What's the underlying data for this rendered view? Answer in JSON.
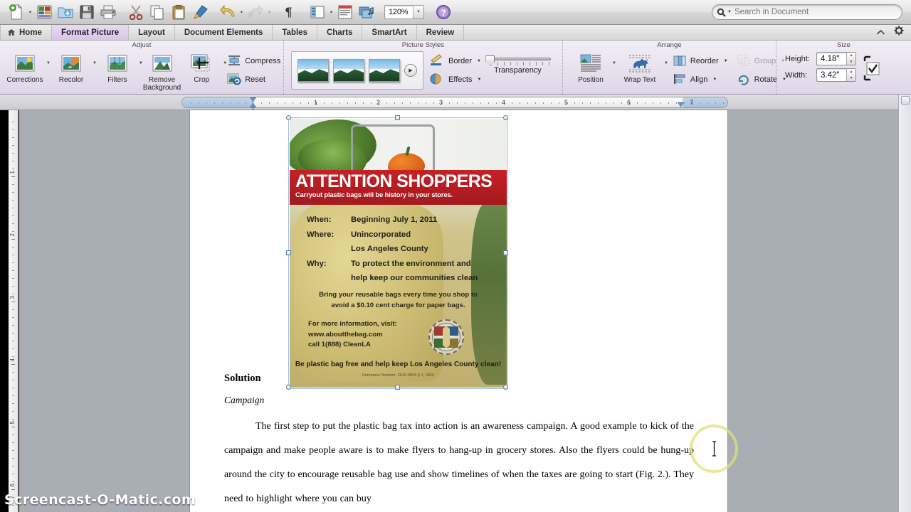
{
  "toolbar": {
    "buttons": [
      {
        "name": "new-document-button",
        "icon": "new-doc-icon",
        "has_arrow": true
      },
      {
        "name": "open-template-gallery-button",
        "icon": "template-gallery-icon",
        "has_arrow": false
      },
      {
        "name": "open-button",
        "icon": "open-folder-icon",
        "has_arrow": false
      },
      {
        "name": "save-button",
        "icon": "floppy-disk-icon",
        "has_arrow": false
      },
      {
        "name": "print-button",
        "icon": "printer-icon",
        "has_arrow": false
      },
      {
        "name": "cut-button",
        "icon": "scissors-icon",
        "has_arrow": false
      },
      {
        "name": "copy-button",
        "icon": "copy-pages-icon",
        "has_arrow": false
      },
      {
        "name": "paste-button",
        "icon": "clipboard-icon",
        "has_arrow": false
      },
      {
        "name": "format-painter-button",
        "icon": "paintbrush-icon",
        "has_arrow": false
      },
      {
        "name": "undo-button",
        "icon": "undo-arrow-icon",
        "has_arrow": true
      },
      {
        "name": "redo-button",
        "icon": "redo-arrow-icon",
        "has_arrow": true
      },
      {
        "name": "show-formatting-button",
        "icon": "pilcrow-icon",
        "has_arrow": false
      },
      {
        "name": "sidebar-button",
        "icon": "sidebar-panel-icon",
        "has_arrow": true
      },
      {
        "name": "notebook-layout-button",
        "icon": "notebook-icon",
        "has_arrow": false
      },
      {
        "name": "media-browser-button",
        "icon": "media-browser-icon",
        "has_arrow": false
      }
    ],
    "zoom_value": "120%",
    "help_label": "?"
  },
  "search": {
    "placeholder": "Search in Document",
    "value": "",
    "icon": "search-magnifier-icon"
  },
  "tabs": [
    {
      "label": "Home",
      "active": false,
      "icon": "home-icon"
    },
    {
      "label": "Format Picture",
      "active": true
    },
    {
      "label": "Layout",
      "active": false
    },
    {
      "label": "Document Elements",
      "active": false
    },
    {
      "label": "Tables",
      "active": false
    },
    {
      "label": "Charts",
      "active": false
    },
    {
      "label": "SmartArt",
      "active": false
    },
    {
      "label": "Review",
      "active": false
    }
  ],
  "tab_tools": [
    {
      "name": "collapse-ribbon-chevron-icon",
      "glyph": "⌃"
    },
    {
      "name": "ribbon-settings-gear-icon",
      "glyph": "⚙"
    }
  ],
  "ribbon": {
    "groups": [
      {
        "title": "Adjust",
        "buttons": [
          {
            "label": "Corrections",
            "icon": "corrections-icon",
            "caret": true
          },
          {
            "label": "Recolor",
            "icon": "recolor-icon",
            "caret": true
          },
          {
            "label": "Filters",
            "icon": "filters-icon",
            "caret": true
          },
          {
            "label": "Remove Background",
            "icon": "remove-background-icon",
            "caret": false
          },
          {
            "label": "Crop",
            "icon": "crop-icon",
            "caret": true
          }
        ],
        "small_buttons": [
          {
            "label": "Compress",
            "icon": "compress-icon"
          },
          {
            "label": "Reset",
            "icon": "reset-picture-icon"
          }
        ]
      },
      {
        "title": "Picture Styles",
        "gallery_count": 3,
        "gallery_more_label": "▶",
        "small_buttons": [
          {
            "label": "Border",
            "icon": "border-pencil-icon",
            "caret": true
          },
          {
            "label": "Effects",
            "icon": "effects-icon",
            "caret": true
          }
        ],
        "transparency_label": "Transparency"
      },
      {
        "title": "Arrange",
        "buttons": [
          {
            "label": "Position",
            "icon": "position-icon",
            "caret": true
          },
          {
            "label": "Wrap Text",
            "icon": "wrap-text-dog-icon",
            "caret": true
          }
        ],
        "small_buttons": [
          {
            "label": "Reorder",
            "icon": "reorder-icon",
            "caret": true,
            "disabled": false
          },
          {
            "label": "Group",
            "icon": "group-icon",
            "caret": true,
            "disabled": true
          },
          {
            "label": "Align",
            "icon": "align-icon",
            "caret": true,
            "disabled": false
          },
          {
            "label": "Rotate",
            "icon": "rotate-icon",
            "caret": true,
            "disabled": false
          }
        ]
      },
      {
        "title": "Size",
        "fields": [
          {
            "label": "Height:",
            "value": "4.18\"",
            "name": "height-field"
          },
          {
            "label": "Width:",
            "value": "3.42\"",
            "name": "width-field"
          }
        ],
        "lock_aspect": {
          "name": "lock-aspect-ratio-checkbox",
          "checked": true
        }
      }
    ]
  },
  "rulers": {
    "horizontal_labels": [
      "1",
      "2",
      "3",
      "4",
      "5",
      "6",
      "7"
    ],
    "vertical_labels": [
      "1",
      "2",
      "3",
      "4",
      "5",
      "6"
    ]
  },
  "poster": {
    "banner_title": "ATTENTION SHOPPERS",
    "banner_subtitle": "Carryout plastic bags will be history in your stores.",
    "details": [
      {
        "key": "When:",
        "value": "Beginning July 1, 2011"
      },
      {
        "key": "Where:",
        "value": "Unincorporated"
      },
      {
        "key": "",
        "value": "Los Angeles County"
      },
      {
        "key": "Why:",
        "value": "To protect the environment and"
      },
      {
        "key": "",
        "value": "help keep our communities clean"
      }
    ],
    "body_line1": "Bring your reusable bags every time you shop to",
    "body_line2": "avoid a $0.10 cent charge for paper bags.",
    "contact_line1": "For more information, visit:",
    "contact_line2": "www.aboutthebag.com",
    "contact_line3": "call 1(888) CleanLA",
    "tagline": "Be plastic bag free and help keep Los Angeles County clean!",
    "ordinance": "Ordinance Number: 2010-0059 § 1, 2010",
    "seal_name": "los-angeles-county-seal-icon"
  },
  "document": {
    "heading": "Solution",
    "subheading": "Campaign",
    "paragraph": "The first step to put the plastic bag tax into action is an awareness campaign. A good example to kick of the campaign and make people aware is to make flyers to hang-up in grocery stores. Also the flyers could be hung-up around the city to encourage reusable bag use and show timelines of when the taxes are going to start (Fig. 2.). They need to highlight where you can buy"
  },
  "watermark": "Screencast-O-Matic.com",
  "colors": {
    "ribbon_accent": "#d9c6e8",
    "banner_red": "#c62127",
    "selection_blue": "#5d7fa5",
    "cursor_highlight": "#dee278"
  }
}
